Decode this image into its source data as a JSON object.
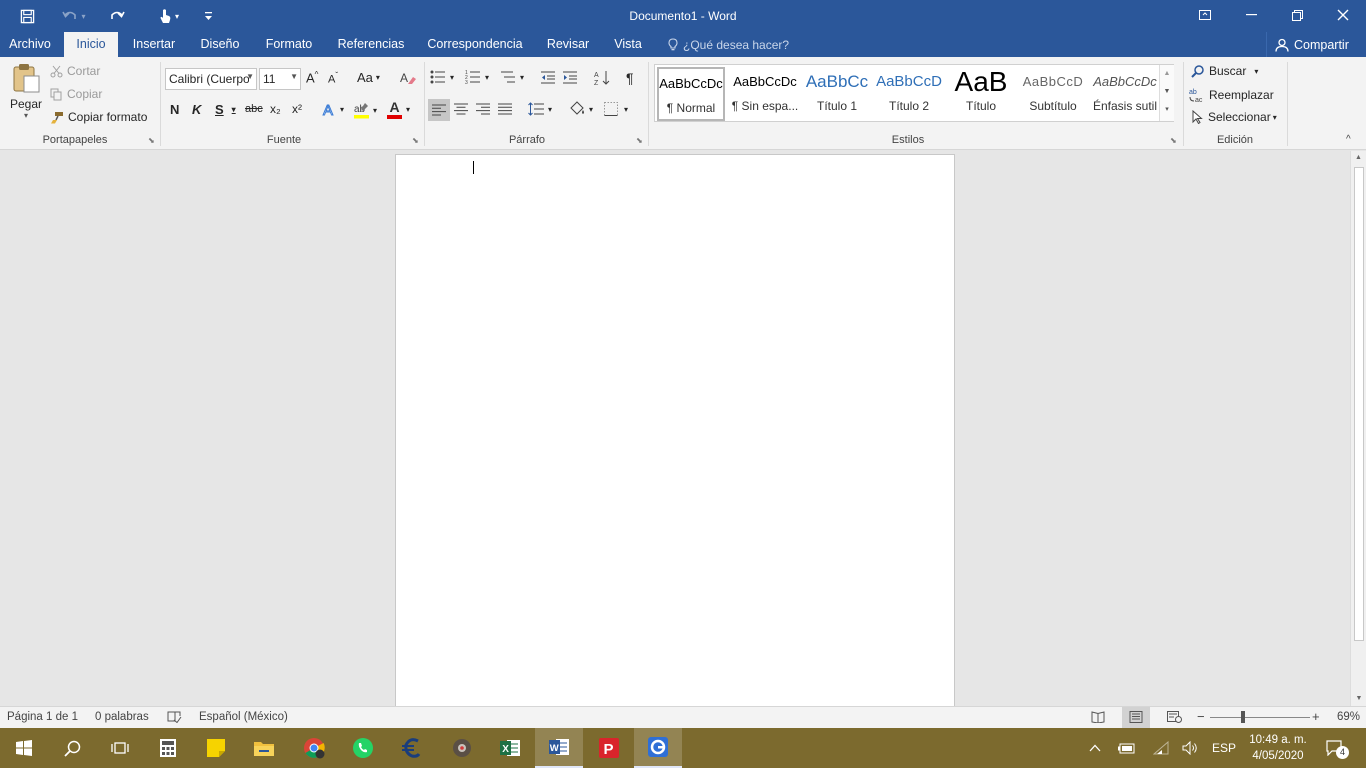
{
  "title": "Documento1 - Word",
  "colors": {
    "accent": "#2b579a",
    "taskbar": "#7c6a2e"
  },
  "quick_access": {
    "icons": [
      "save-icon",
      "undo-icon",
      "redo-icon",
      "touch-mode-icon",
      "customize-icon"
    ]
  },
  "window_controls": {
    "icons": [
      "ribbon-display-icon",
      "minimize-icon",
      "restore-icon",
      "close-icon"
    ]
  },
  "tabs": [
    {
      "label": "Archivo"
    },
    {
      "label": "Inicio",
      "active": true
    },
    {
      "label": "Insertar"
    },
    {
      "label": "Diseño"
    },
    {
      "label": "Formato"
    },
    {
      "label": "Referencias"
    },
    {
      "label": "Correspondencia"
    },
    {
      "label": "Revisar"
    },
    {
      "label": "Vista"
    }
  ],
  "tell_me": "¿Qué desea hacer?",
  "share": "Compartir",
  "clipboard": {
    "label": "Portapapeles",
    "paste": "Pegar",
    "cut": "Cortar",
    "copy": "Copiar",
    "format_painter": "Copiar formato"
  },
  "font": {
    "label": "Fuente",
    "font_name": "Calibri (Cuerpo)",
    "font_size": "11",
    "change_case": "Aa",
    "bold": "N",
    "italic": "K",
    "underline": "S",
    "strike": "abc",
    "subscript": "x₂",
    "superscript": "x²",
    "font_color": "A",
    "highlight_color": "#ffff00",
    "text_color": "#e00000"
  },
  "paragraph": {
    "label": "Párrafo"
  },
  "styles": {
    "label": "Estilos",
    "items": [
      {
        "preview": "AaBbCcDc",
        "name": "¶ Normal"
      },
      {
        "preview": "AaBbCcDc",
        "name": "¶ Sin espa..."
      },
      {
        "preview": "AaBbCc",
        "name": "Título 1"
      },
      {
        "preview": "AaBbCcD",
        "name": "Título 2"
      },
      {
        "preview": "AaB",
        "name": "Título"
      },
      {
        "preview": "AaBbCcD",
        "name": "Subtítulo"
      },
      {
        "preview": "AaBbCcDc",
        "name": "Énfasis sutil"
      }
    ]
  },
  "editing": {
    "label": "Edición",
    "find": "Buscar",
    "replace": "Reemplazar",
    "select": "Seleccionar"
  },
  "status": {
    "page": "Página 1 de 1",
    "words": "0 palabras",
    "language": "Español (México)",
    "zoom_minus": "−",
    "zoom_plus": "+",
    "zoom": "69%",
    "zoom_level": 0.69
  },
  "taskbar": {
    "apps": [
      "windows-start-icon",
      "search-icon",
      "task-view-icon",
      "calculator-icon",
      "sticky-notes-icon",
      "file-explorer-icon",
      "chrome-icon",
      "whatsapp-icon",
      "euro-app-icon",
      "media-app-icon",
      "excel-icon",
      "word-icon",
      "psiphon-icon",
      "app-g-icon"
    ],
    "lang": "ESP",
    "time": "10:49 a. m.",
    "date": "4/05/2020",
    "notifications": "4"
  }
}
